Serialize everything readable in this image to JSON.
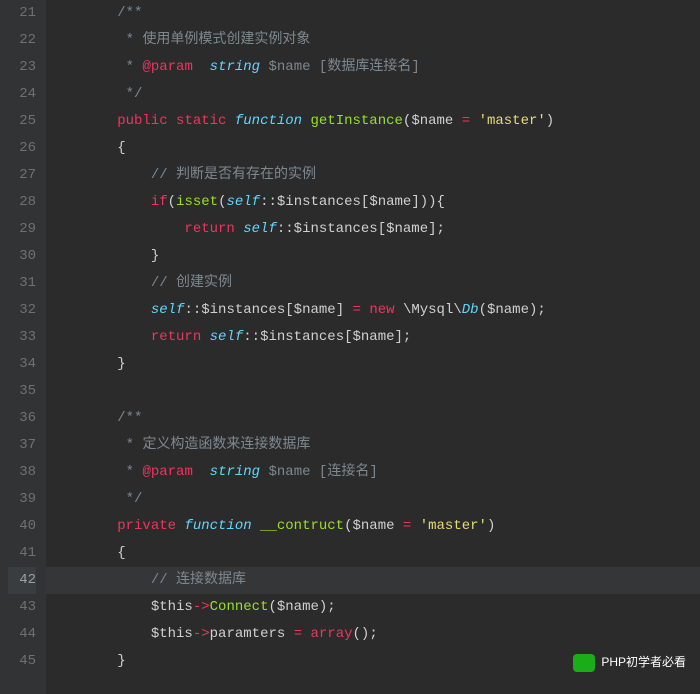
{
  "lines": {
    "21": {
      "n": "21"
    },
    "22": {
      "n": "22",
      "c": "使用单例模式创建实例对象"
    },
    "23": {
      "n": "23",
      "tag": "@param",
      "typ": "string",
      "var": "$name",
      "desc": "[数据库连接名]"
    },
    "24": {
      "n": "24"
    },
    "25": {
      "n": "25",
      "kw1": "public",
      "kw2": "static",
      "fn": "function",
      "name": "getInstance",
      "var": "$name",
      "eq": "=",
      "str": "'master'"
    },
    "26": {
      "n": "26"
    },
    "27": {
      "n": "27",
      "c": "// 判断是否有存在的实例"
    },
    "28": {
      "n": "28",
      "kw": "if",
      "call": "isset",
      "self": "self",
      "var": "$instances",
      "arg": "$name"
    },
    "29": {
      "n": "29",
      "kw": "return",
      "self": "self",
      "var": "$instances",
      "arg": "$name"
    },
    "30": {
      "n": "30"
    },
    "31": {
      "n": "31",
      "c": "// 创建实例"
    },
    "32": {
      "n": "32",
      "self": "self",
      "var": "$instances",
      "arg": "$name",
      "kw": "new",
      "ns": "\\Mysql\\",
      "cls": "Db"
    },
    "33": {
      "n": "33",
      "kw": "return",
      "self": "self",
      "var": "$instances",
      "arg": "$name"
    },
    "34": {
      "n": "34"
    },
    "35": {
      "n": "35"
    },
    "36": {
      "n": "36"
    },
    "37": {
      "n": "37",
      "c": "定义构造函数来连接数据库"
    },
    "38": {
      "n": "38",
      "tag": "@param",
      "typ": "string",
      "var": "$name",
      "desc": "[连接名]"
    },
    "39": {
      "n": "39"
    },
    "40": {
      "n": "40",
      "kw1": "private",
      "fn": "function",
      "name": "__contruct",
      "var": "$name",
      "eq": "=",
      "str": "'master'"
    },
    "41": {
      "n": "41"
    },
    "42": {
      "n": "42",
      "c": "// 连接数据库"
    },
    "43": {
      "n": "43",
      "this": "$this",
      "arrow": "->",
      "call": "Connect",
      "arg": "$name"
    },
    "44": {
      "n": "44",
      "this": "$this",
      "arrow": "->",
      "prop": "paramters",
      "kw": "array"
    },
    "45": {
      "n": "45"
    }
  },
  "overlay": {
    "label": "PHP初学者必看"
  }
}
